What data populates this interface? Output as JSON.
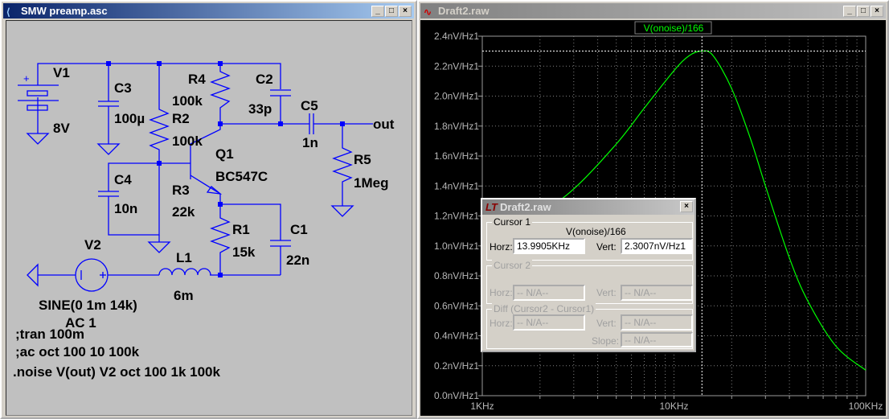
{
  "schematic_window": {
    "title": "SMW preamp.asc",
    "buttons": [
      "_",
      "□",
      "×"
    ]
  },
  "schematic": {
    "components": {
      "V1": {
        "name": "V1",
        "value": "8V"
      },
      "C3": {
        "name": "C3",
        "value": "100µ"
      },
      "R2": {
        "name": "R2",
        "value": "100k"
      },
      "R4": {
        "name": "R4",
        "value": "100k"
      },
      "C2": {
        "name": "C2",
        "value": "33p"
      },
      "C5": {
        "name": "C5",
        "value": "1n"
      },
      "R5": {
        "name": "R5",
        "value": "1Meg"
      },
      "Q1": {
        "name": "Q1",
        "value": "BC547C"
      },
      "C4": {
        "name": "C4",
        "value": "10n"
      },
      "R3": {
        "name": "R3",
        "value": "22k"
      },
      "R1": {
        "name": "R1",
        "value": "15k"
      },
      "C1": {
        "name": "C1",
        "value": "22n"
      },
      "L1": {
        "name": "L1",
        "value": "6m"
      },
      "V2": {
        "name": "V2",
        "value": "SINE(0 1m 14k)",
        "value2": "AC 1"
      }
    },
    "plus_sign": "+",
    "net_label": "out",
    "directives": [
      ";tran 100m",
      ";ac oct 100 10 100k",
      ".noise V(out) V2 oct 100 1k 100k"
    ]
  },
  "plot_window": {
    "title": "Draft2.raw",
    "buttons": [
      "_",
      "□",
      "×"
    ]
  },
  "chart_data": {
    "type": "line",
    "series": [
      {
        "name": "V(onoise)/166",
        "color": "#00ff00",
        "x": [
          1000,
          2000,
          3000,
          5000,
          7000,
          10000,
          12000,
          13990.5,
          16000,
          20000,
          25000,
          30000,
          40000,
          50000,
          70000,
          100000
        ],
        "y": [
          1.0,
          1.22,
          1.38,
          1.68,
          1.92,
          2.17,
          2.27,
          2.3007,
          2.27,
          2.05,
          1.72,
          1.4,
          0.92,
          0.63,
          0.33,
          0.17
        ]
      }
    ],
    "xscale": "log",
    "xlim": [
      1000,
      100000
    ],
    "ylim": [
      0,
      2.4
    ],
    "xticks": [
      "1KHz",
      "10KHz",
      "100KHz"
    ],
    "yticks": [
      "0.0nV/Hz1",
      "0.2nV/Hz1",
      "0.4nV/Hz1",
      "0.6nV/Hz1",
      "0.8nV/Hz1",
      "1.0nV/Hz1",
      "1.2nV/Hz1",
      "1.4nV/Hz1",
      "1.6nV/Hz1",
      "1.8nV/Hz1",
      "2.0nV/Hz1",
      "2.2nV/Hz1",
      "2.4nV/Hz1"
    ],
    "grid": true,
    "background": "#000000",
    "cursor": {
      "x": 13990.5,
      "y": 2.3007
    }
  },
  "cursor_dialog": {
    "title": "Draft2.raw",
    "close": "×",
    "cursor1": {
      "label": "Cursor 1",
      "trace": "V(onoise)/166",
      "horz_label": "Horz:",
      "horz": "13.9905KHz",
      "vert_label": "Vert:",
      "vert": "2.3007nV/Hz1"
    },
    "cursor2": {
      "label": "Cursor 2",
      "horz_label": "Horz:",
      "horz": "-- N/A--",
      "vert_label": "Vert:",
      "vert": "-- N/A--"
    },
    "diff": {
      "label": "Diff (Cursor2 - Cursor1)",
      "horz_label": "Horz:",
      "horz": "-- N/A--",
      "vert_label": "Vert:",
      "vert": "-- N/A--",
      "slope_label": "Slope:",
      "slope": "-- N/A--"
    }
  }
}
